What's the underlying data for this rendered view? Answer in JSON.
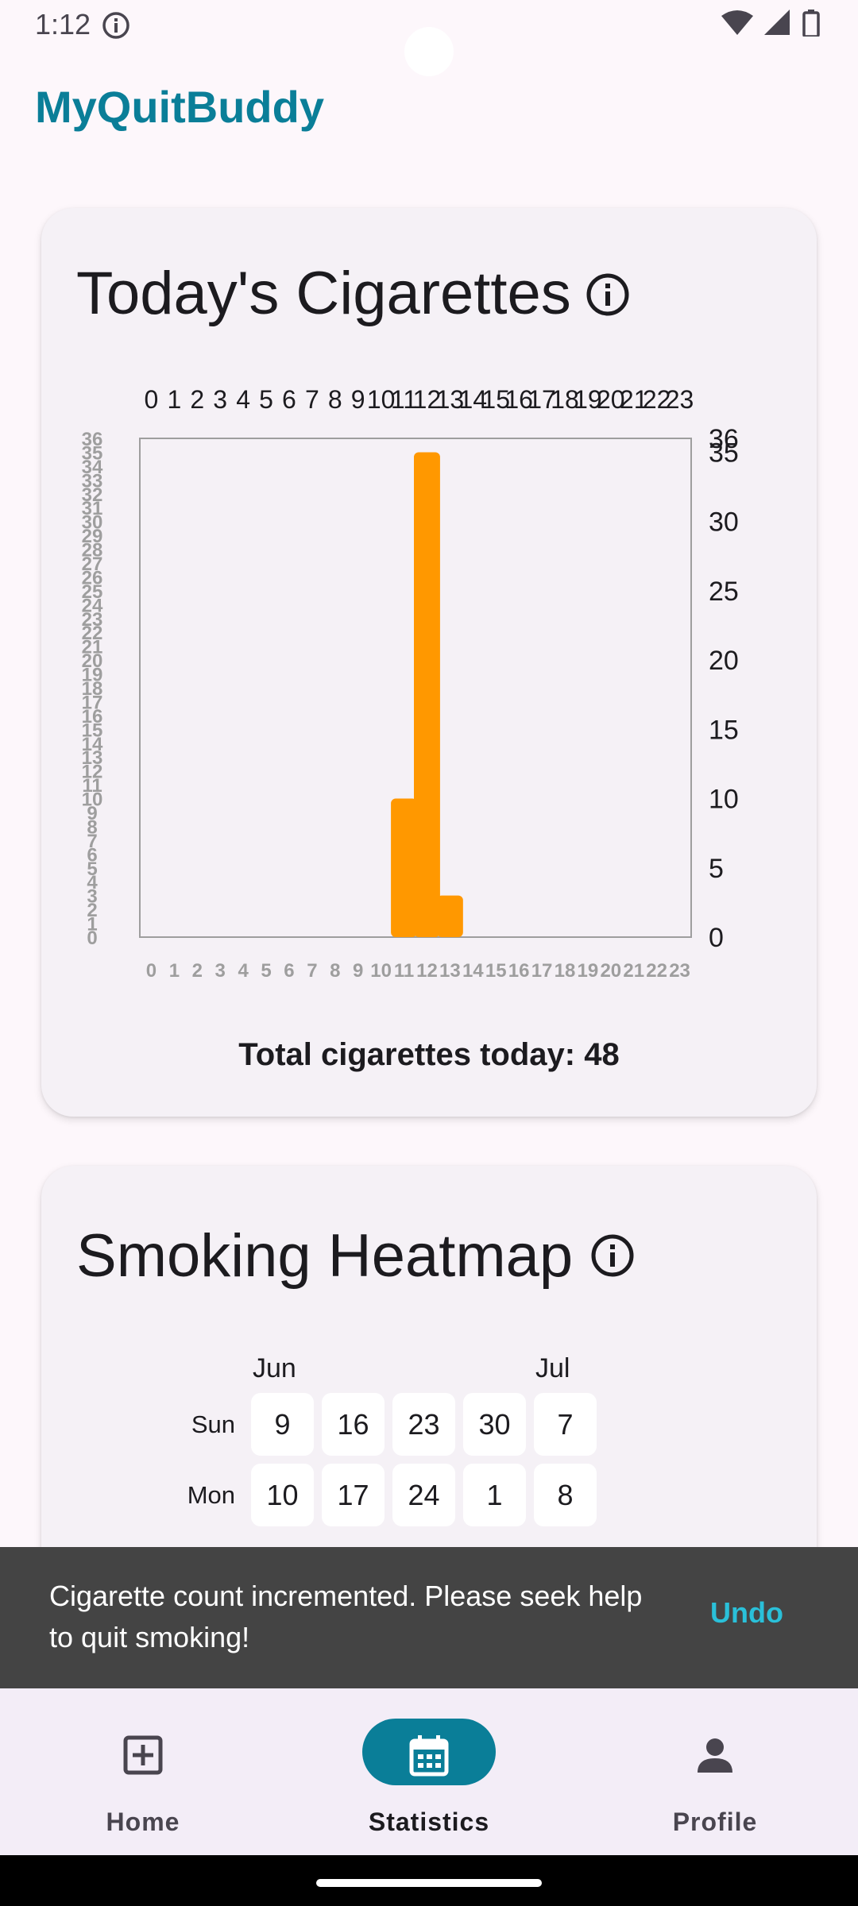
{
  "status_bar": {
    "time": "1:12",
    "icons": [
      "info-icon",
      "wifi-icon",
      "signal-icon",
      "battery-icon"
    ]
  },
  "app": {
    "title": "MyQuitBuddy",
    "accent_color": "#0a7e98"
  },
  "today_card": {
    "title": "Today's Cigarettes",
    "info_icon": "info-icon",
    "total_label": "Total cigarettes today: 48"
  },
  "chart_data": {
    "type": "bar",
    "title": "",
    "categories": [
      "0",
      "1",
      "2",
      "3",
      "4",
      "5",
      "6",
      "7",
      "8",
      "9",
      "10",
      "11",
      "12",
      "13",
      "14",
      "15",
      "16",
      "17",
      "18",
      "19",
      "20",
      "21",
      "22",
      "23"
    ],
    "values": [
      0,
      0,
      0,
      0,
      0,
      0,
      0,
      0,
      0,
      0,
      0,
      10,
      35,
      3,
      0,
      0,
      0,
      0,
      0,
      0,
      0,
      0,
      0,
      0
    ],
    "bar_color": "#ff9800",
    "ylim": [
      0,
      36
    ],
    "left_axis_ticks": [
      "0",
      "1",
      "2",
      "3",
      "4",
      "5",
      "6",
      "7",
      "8",
      "9",
      "10",
      "11",
      "12",
      "13",
      "14",
      "15",
      "16",
      "17",
      "18",
      "19",
      "20",
      "21",
      "22",
      "23",
      "24",
      "25",
      "26",
      "27",
      "28",
      "29",
      "30",
      "31",
      "32",
      "33",
      "34",
      "35",
      "36"
    ],
    "right_axis_ticks": [
      "0",
      "5",
      "10",
      "15",
      "20",
      "25",
      "30",
      "35",
      "36"
    ],
    "top_axis_labels": [
      "0",
      "1",
      "2",
      "3",
      "4",
      "5",
      "6",
      "7",
      "8",
      "9",
      "10",
      "11",
      "12",
      "13",
      "14",
      "15",
      "16",
      "17",
      "18",
      "19",
      "20",
      "21",
      "22",
      "23"
    ],
    "bottom_axis_labels": [
      "0",
      "1",
      "2",
      "3",
      "4",
      "5",
      "6",
      "7",
      "8",
      "9",
      "10",
      "11",
      "12",
      "13",
      "14",
      "15",
      "16",
      "17",
      "18",
      "19",
      "20",
      "21",
      "22",
      "23"
    ],
    "grid": false
  },
  "heatmap_card": {
    "title": "Smoking Heatmap",
    "info_icon": "info-icon",
    "months": [
      {
        "label": "Jun",
        "column": 0
      },
      {
        "label": "Jul",
        "column": 4
      }
    ],
    "rows": [
      {
        "day": "Sun",
        "cells": [
          "9",
          "16",
          "23",
          "30",
          "7"
        ]
      },
      {
        "day": "Mon",
        "cells": [
          "10",
          "17",
          "24",
          "1",
          "8"
        ]
      }
    ]
  },
  "snackbar": {
    "message": "Cigarette count incremented. Please seek help to quit smoking!",
    "action": "Undo",
    "action_color": "#2ac0d9"
  },
  "bottom_nav": {
    "items": [
      {
        "label": "Home",
        "icon": "add-box-icon",
        "active": false
      },
      {
        "label": "Statistics",
        "icon": "calendar-icon",
        "active": true
      },
      {
        "label": "Profile",
        "icon": "person-icon",
        "active": false
      }
    ]
  }
}
